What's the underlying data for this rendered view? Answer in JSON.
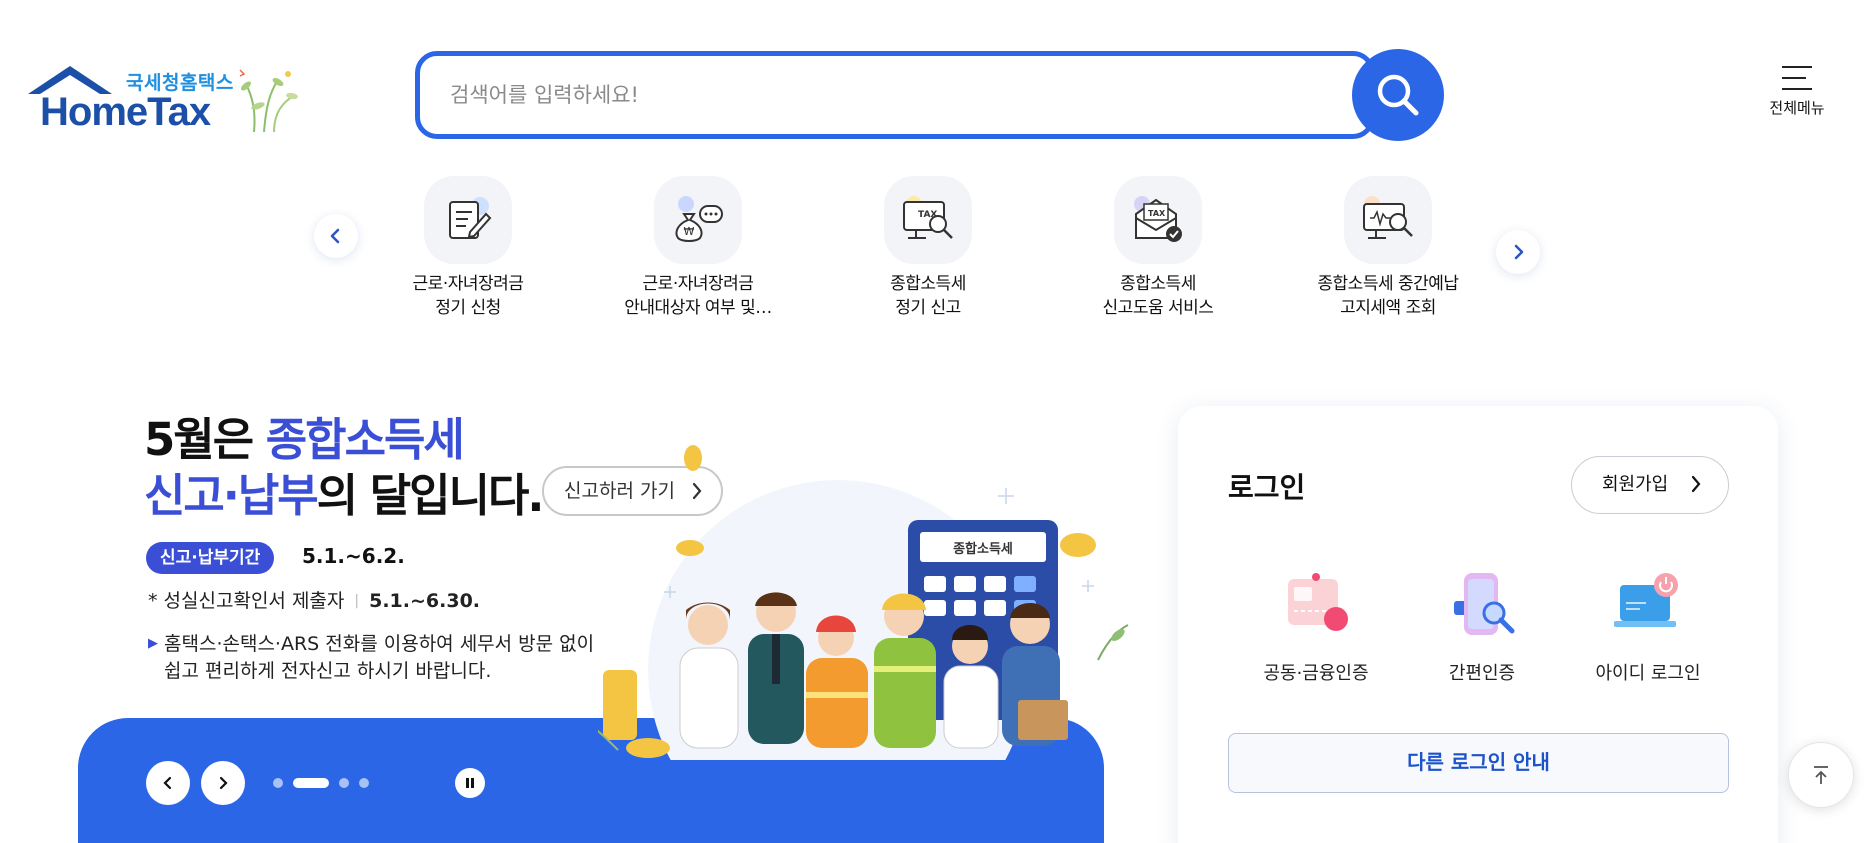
{
  "header": {
    "logo_kr": "국세청홈택스",
    "logo_en": "HomeTax",
    "search": {
      "placeholder": "검색어를 입력하세요!",
      "value": ""
    },
    "search_icon": "search-icon",
    "menu_label": "전체메뉴"
  },
  "quick_links": [
    {
      "line1": "근로·자녀장려금",
      "line2": "정기 신청",
      "icon": "application-form-icon"
    },
    {
      "line1": "근로·자녀장려금",
      "line2": "안내대상자 여부 및…",
      "icon": "money-bag-chat-icon"
    },
    {
      "line1": "종합소득세",
      "line2": "정기 신고",
      "icon": "tax-monitor-search-icon"
    },
    {
      "line1": "종합소득세",
      "line2": "신고도움 서비스",
      "icon": "tax-envelope-check-icon"
    },
    {
      "line1": "종합소득세 중간예납",
      "line2": "고지세액 조회",
      "icon": "won-monitor-search-icon"
    }
  ],
  "banner": {
    "line1_pre": "5월은 ",
    "line1_hl": "종합소득세",
    "line2_hl": "신고·납부",
    "line2_post": "의 달입니다.",
    "cta": "신고하러 가기",
    "period_badge": "신고·납부기간",
    "period_value": "5.1.~6.2.",
    "note_label": "* 성실신고확인서 제출자",
    "note_value": "5.1.~6.30.",
    "desc_line1": "홈택스·손택스·ARS 전화를 이용하여 세무서 방문 없이",
    "desc_line2": "쉽고 편리하게 전자신고 하시기 바랍니다.",
    "calculator_label": "종합소득세",
    "slide_count": 4,
    "active_slide": 2
  },
  "login": {
    "title": "로그인",
    "signup": "회원가입",
    "options": [
      {
        "label": "공동·금융인증",
        "icon": "certificate-card-icon"
      },
      {
        "label": "간편인증",
        "icon": "phone-search-icon"
      },
      {
        "label": "아이디 로그인",
        "icon": "laptop-power-icon"
      }
    ],
    "other_login": "다른 로그인 안내"
  },
  "colors": {
    "primary": "#2a66e6",
    "accent": "#3a4fd6",
    "logo_blue": "#1c4fa8"
  }
}
